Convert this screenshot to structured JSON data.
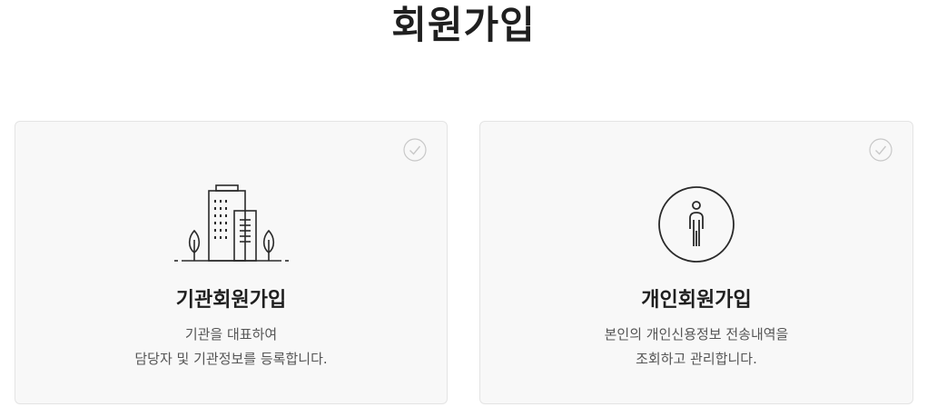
{
  "page": {
    "title": "회원가입"
  },
  "cards": [
    {
      "title": "기관회원가입",
      "desc_line1": "기관을 대표하여",
      "desc_line2": "담당자 및 기관정보를 등록합니다.",
      "icon": "building-icon",
      "check_icon": "check-circle-icon"
    },
    {
      "title": "개인회원가입",
      "desc_line1": "본인의 개인신용정보 전송내역을",
      "desc_line2": "조회하고 관리합니다.",
      "icon": "person-icon",
      "check_icon": "check-circle-icon"
    }
  ],
  "colors": {
    "card_bg": "#f8f8f8",
    "card_border": "#e4e4e4",
    "icon_stroke": "#2a2a2a",
    "check": "#c8c8c8"
  }
}
